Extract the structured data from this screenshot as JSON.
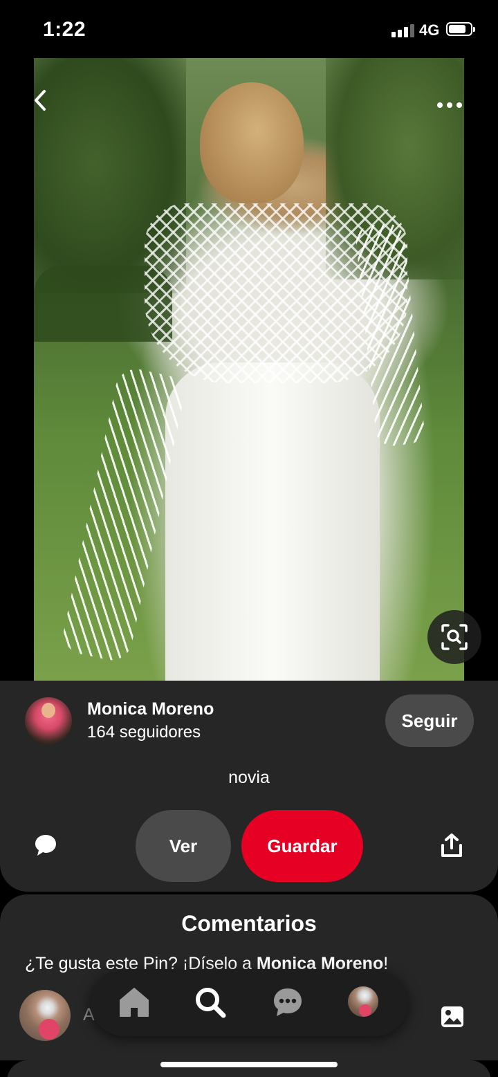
{
  "status_bar": {
    "time": "1:22",
    "network": "4G",
    "icons": [
      "signal-icon",
      "battery-icon"
    ]
  },
  "pin": {
    "image_description_icons": [
      "back-chevron-icon",
      "more-options-icon",
      "visual-search-icon"
    ],
    "title": "novia"
  },
  "creator": {
    "name": "Monica Moreno",
    "followers": "164 seguidores",
    "follow_label": "Seguir"
  },
  "actions": {
    "view_label": "Ver",
    "save_label": "Guardar",
    "icons": [
      "comment-icon",
      "share-icon"
    ]
  },
  "comments": {
    "title": "Comentarios",
    "prompt_prefix": "¿Te gusta este Pin? ¡Díselo a ",
    "prompt_name": "Monica Moreno",
    "prompt_suffix": "!",
    "input_placeholder": "A"
  },
  "tab_bar": {
    "tabs": [
      "home-icon",
      "search-icon",
      "messages-icon",
      "profile-avatar"
    ]
  },
  "colors": {
    "background": "#000000",
    "card": "#262626",
    "secondary_button": "#4a4a4a",
    "save_button": "#e60023",
    "tab_bar": "#1d1d1d"
  }
}
